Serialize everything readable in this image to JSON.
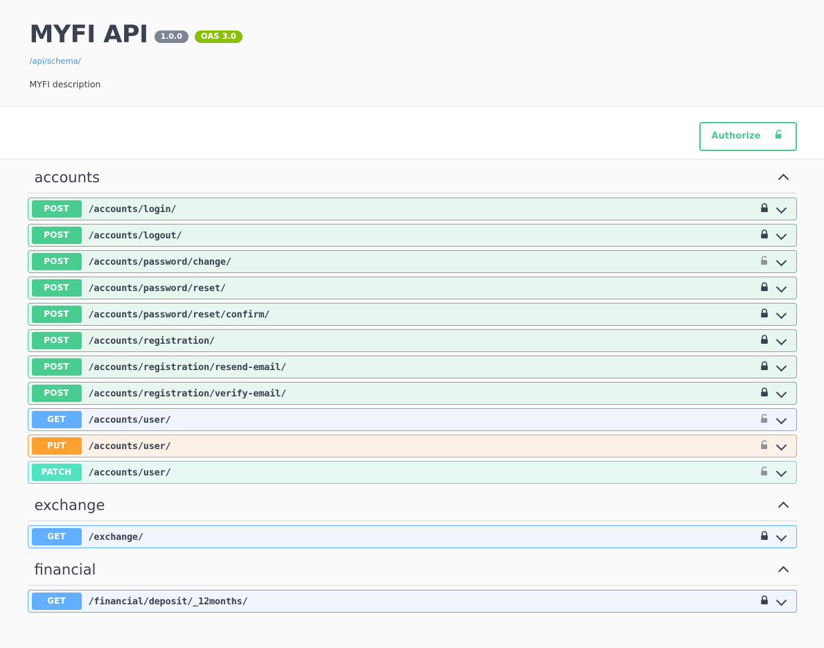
{
  "header": {
    "title": "MYFI API",
    "version_badge": "1.0.0",
    "oas_badge": "OAS 3.0",
    "schema_link": "/api/schema/",
    "description": "MYFI description"
  },
  "auth": {
    "authorize_label": "Authorize",
    "lock_state": "unlocked"
  },
  "colors": {
    "post": "#49cc90",
    "get": "#61affe",
    "put": "#fca130",
    "patch": "#50e3c2",
    "oas_badge": "#89bf04",
    "version_badge": "#7d8492",
    "link": "#4990e2",
    "text": "#3b4151"
  },
  "tags": [
    {
      "name": "accounts",
      "expanded": true,
      "operations": [
        {
          "method": "POST",
          "path": "/accounts/login/",
          "lock": "locked"
        },
        {
          "method": "POST",
          "path": "/accounts/logout/",
          "lock": "locked"
        },
        {
          "method": "POST",
          "path": "/accounts/password/change/",
          "lock": "unlocked"
        },
        {
          "method": "POST",
          "path": "/accounts/password/reset/",
          "lock": "locked"
        },
        {
          "method": "POST",
          "path": "/accounts/password/reset/confirm/",
          "lock": "locked"
        },
        {
          "method": "POST",
          "path": "/accounts/registration/",
          "lock": "locked"
        },
        {
          "method": "POST",
          "path": "/accounts/registration/resend-email/",
          "lock": "locked"
        },
        {
          "method": "POST",
          "path": "/accounts/registration/verify-email/",
          "lock": "locked"
        },
        {
          "method": "GET",
          "path": "/accounts/user/",
          "lock": "unlocked"
        },
        {
          "method": "PUT",
          "path": "/accounts/user/",
          "lock": "unlocked"
        },
        {
          "method": "PATCH",
          "path": "/accounts/user/",
          "lock": "unlocked"
        }
      ]
    },
    {
      "name": "exchange",
      "expanded": true,
      "operations": [
        {
          "method": "GET",
          "path": "/exchange/",
          "lock": "locked"
        }
      ]
    },
    {
      "name": "financial",
      "expanded": true,
      "operations": [
        {
          "method": "GET",
          "path": "/financial/deposit/_12months/",
          "lock": "locked"
        }
      ]
    }
  ]
}
